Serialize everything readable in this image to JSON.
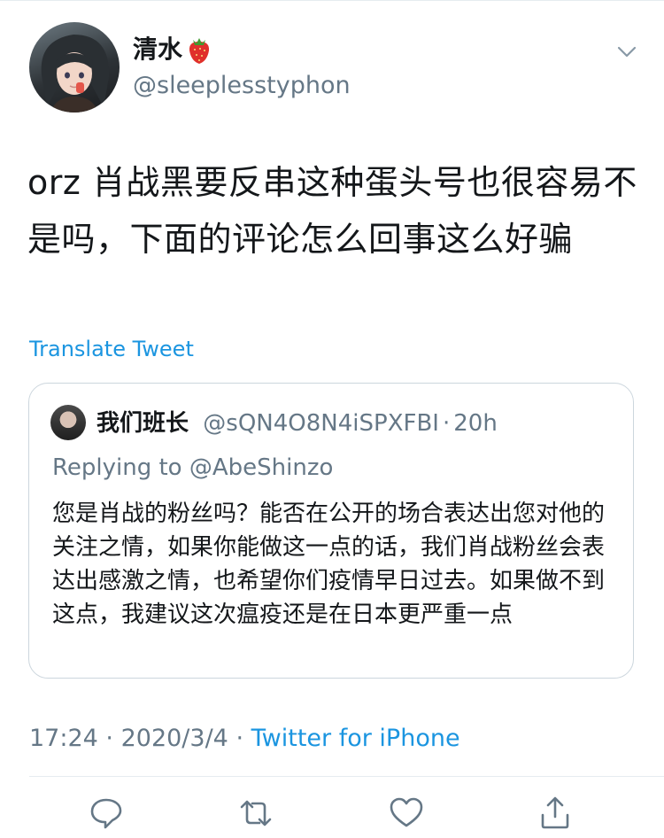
{
  "author": {
    "display_name": "清水",
    "handle": "@sleeplesstyphon",
    "emoji_icon": "strawberry-icon"
  },
  "tweet": {
    "text": "orz 肖战黑要反串这种蛋头号也很容易不是吗，下面的评论怎么回事这么好骗",
    "translate_label": "Translate Tweet"
  },
  "quoted_tweet": {
    "display_name": "我们班长",
    "handle": "@sQN4O8N4iSPXFBI",
    "separator": "·",
    "time_ago": "20h",
    "replying_prefix": "Replying to",
    "replying_to": "@AbeShinzo",
    "text": "您是肖战的粉丝吗？能否在公开的场合表达出您对他的关注之情，如果你能做这一点的话，我们肖战粉丝会表达出感激之情，也希望你们疫情早日过去。如果做不到这点，我建议这次瘟疫还是在日本更严重一点"
  },
  "meta": {
    "time": "17:24",
    "date": "2020/3/4",
    "separator": "·",
    "source": "Twitter for iPhone"
  },
  "actions": [
    {
      "icon": "reply-icon"
    },
    {
      "icon": "retweet-icon"
    },
    {
      "icon": "like-icon"
    },
    {
      "icon": "share-icon"
    }
  ],
  "colors": {
    "link": "#1b95e0",
    "secondary_text": "#657786",
    "border": "#ccd6dd",
    "icon": "#657786"
  }
}
